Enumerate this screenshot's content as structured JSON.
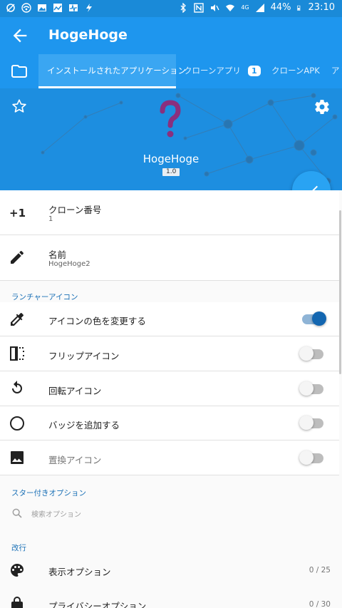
{
  "status_bar": {
    "battery": "44%",
    "time": "23:10",
    "network": "4G"
  },
  "app_bar": {
    "title": "HogeHoge"
  },
  "tabs": [
    {
      "label": "インストールされたアプリケーション",
      "active": true
    },
    {
      "label": "クローンアプリ",
      "badge": "1"
    },
    {
      "label": "クローンAPK"
    },
    {
      "label": "アド"
    }
  ],
  "header": {
    "app_name": "HogeHoge",
    "version": "1.0"
  },
  "rows": {
    "clone_number": {
      "label": "クローン番号",
      "value": "1"
    },
    "name": {
      "label": "名前",
      "value": "HogeHoge2"
    }
  },
  "section_launcher": "ランチャーアイコン",
  "launcher_options": [
    {
      "label": "アイコンの色を変更する",
      "on": true
    },
    {
      "label": "フリップアイコン",
      "on": false
    },
    {
      "label": "回転アイコン",
      "on": false
    },
    {
      "label": "バッジを追加する",
      "on": false
    },
    {
      "label": "置換アイコン",
      "on": false
    }
  ],
  "section_starred": "スター付きオプション",
  "search": {
    "placeholder": "検索オプション"
  },
  "section_newline": "改行",
  "option_groups": [
    {
      "label": "表示オプション",
      "count": "0 / 25"
    },
    {
      "label": "プライバシーオプション",
      "count": "0 / 30"
    }
  ],
  "colors": {
    "primary": "#1e96ee",
    "accent": "#29a3f3",
    "section": "#1a70b6"
  }
}
